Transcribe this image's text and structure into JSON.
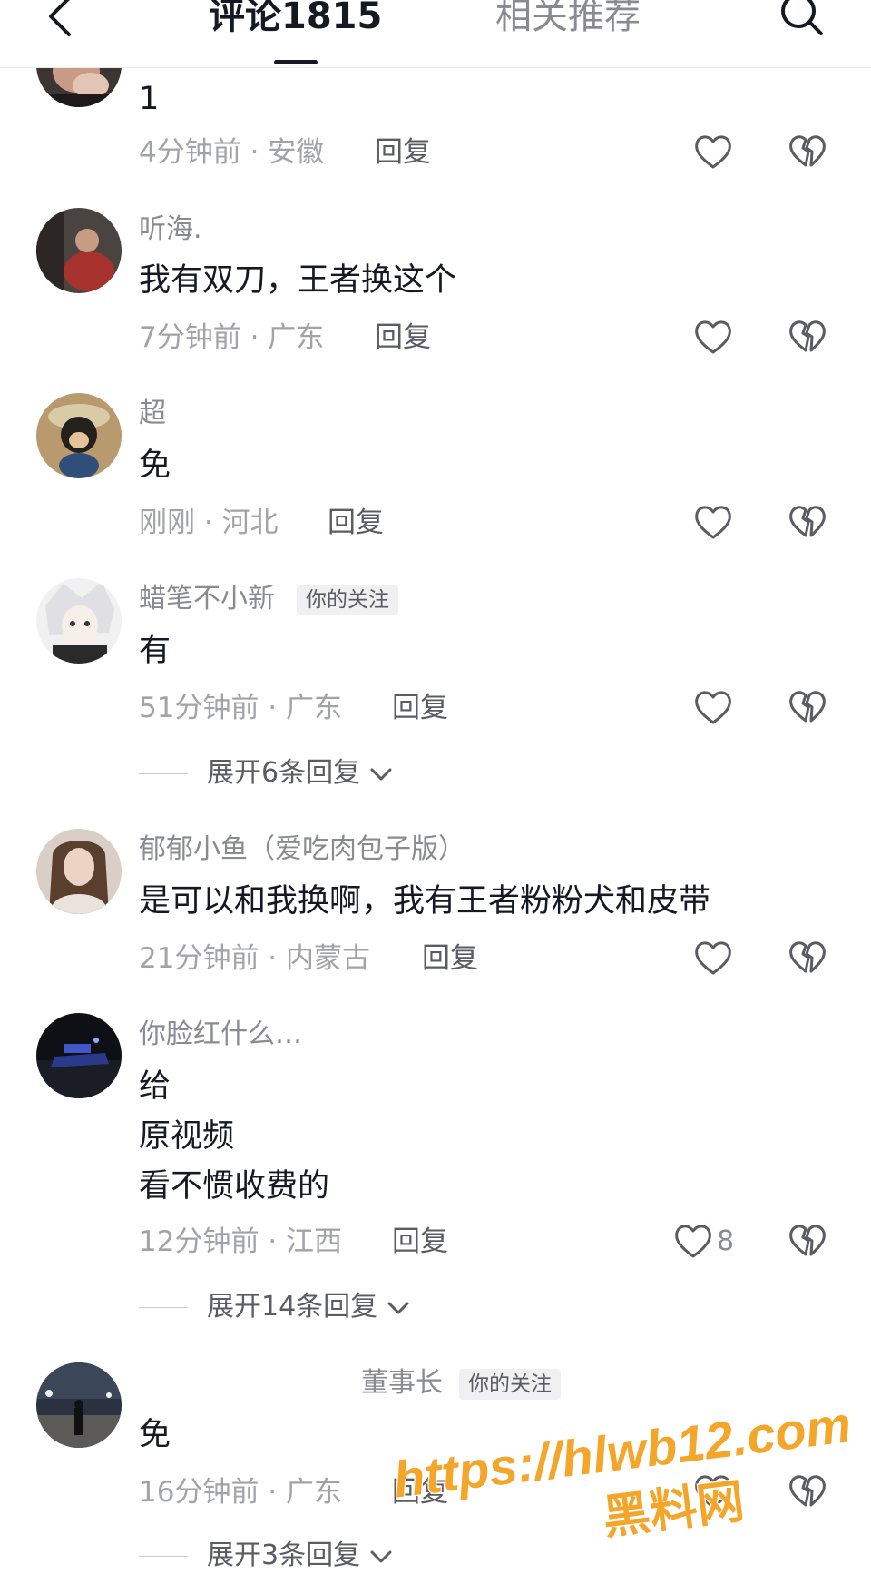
{
  "header": {
    "comments_tab": "评论1815",
    "related_tab": "相关推荐"
  },
  "comments": [
    {
      "text": [
        "1"
      ],
      "time": "4分钟前",
      "region": "安徽",
      "reply_label": "回复"
    },
    {
      "username": "听海.",
      "text": [
        "我有双刀，王者换这个"
      ],
      "time": "7分钟前",
      "region": "广东",
      "reply_label": "回复"
    },
    {
      "username": "超",
      "text": [
        "免"
      ],
      "time": "刚刚",
      "region": "河北",
      "reply_label": "回复"
    },
    {
      "username": "蜡笔不小新",
      "tag": "你的关注",
      "text": [
        "有"
      ],
      "time": "51分钟前",
      "region": "广东",
      "reply_label": "回复",
      "expand_label": "展开6条回复"
    },
    {
      "username": "郁郁小鱼（爱吃肉包子版）",
      "text": [
        "是可以和我换啊，我有王者粉粉犬和皮带"
      ],
      "time": "21分钟前",
      "region": "内蒙古",
      "reply_label": "回复"
    },
    {
      "username": "你脸红什么…",
      "text": [
        "给",
        "原视频",
        "看不惯收费的"
      ],
      "time": "12分钟前",
      "region": "江西",
      "reply_label": "回复",
      "likes": "8",
      "expand_label": "展开14条回复"
    },
    {
      "username": "董事长",
      "tag": "你的关注",
      "text": [
        "免"
      ],
      "time": "16分钟前",
      "region": "广东",
      "reply_label": "回复",
      "expand_label": "展开3条回复"
    }
  ],
  "watermark": {
    "url": "https://hlwb12.com",
    "site": "黑料网"
  },
  "colors": {
    "primary_text": "#161823",
    "secondary_text": "#8a8b91",
    "meta_text": "#a2a3a8",
    "watermark_fill": "#f4a62a",
    "watermark_stroke": "#ffffff"
  }
}
